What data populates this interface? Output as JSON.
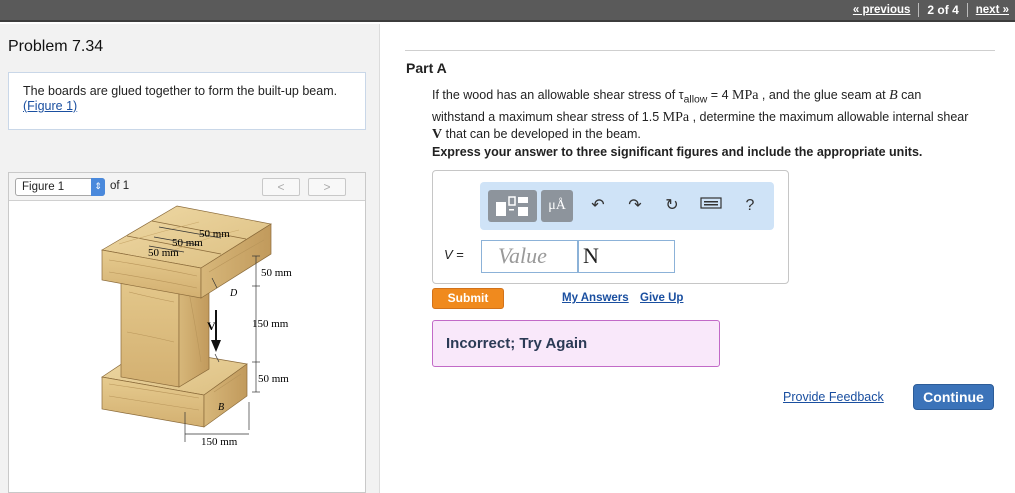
{
  "nav": {
    "previous": "« previous",
    "position": "2 of 4",
    "next": "next »"
  },
  "problem": {
    "title": "Problem 7.34",
    "intro": "The boards are glued together to form the built-up beam.",
    "figure_link": "(Figure 1)"
  },
  "figure_panel": {
    "selected": "Figure 1",
    "of_label": "of 1",
    "prev": "<",
    "next": ">",
    "dims": {
      "top1": "50 mm",
      "top2": "50 mm",
      "top3": "50 mm",
      "right1": "50 mm",
      "right2": "150 mm",
      "right3": "50 mm",
      "bottom": "150 mm",
      "label_d": "D",
      "label_b": "B",
      "label_v": "V"
    }
  },
  "part": {
    "title": "Part A",
    "q1": "If the wood has an allowable shear stress of τ",
    "q_sub": "allow",
    "q2": " = 4 ",
    "q_mpa1": "MPa",
    "q3": " , and the glue seam at ",
    "q_b": "B",
    "q4": " can withstand a maximum shear stress of 1.5 ",
    "q_mpa2": "MPa",
    "q5": " , determine the maximum allowable internal shear ",
    "q_v": "V",
    "q6": " that can be developed in the beam.",
    "instructions": "Express your answer to three significant figures and include the appropriate units."
  },
  "answer": {
    "label": "V =",
    "value_placeholder": "Value",
    "unit_value": "N",
    "toolbar_mu": "μÅ",
    "toolbar_help": "?"
  },
  "actions": {
    "submit": "Submit",
    "my_answers": "My Answers",
    "give_up": "Give Up",
    "feedback": "Incorrect; Try Again",
    "provide_feedback": "Provide Feedback",
    "continue": "Continue"
  },
  "colors": {
    "accent": "#3b73b9",
    "submit": "#f08a1e",
    "feedback_bg": "#f9e8fa",
    "toolbar_bg": "#cfe3f7"
  }
}
